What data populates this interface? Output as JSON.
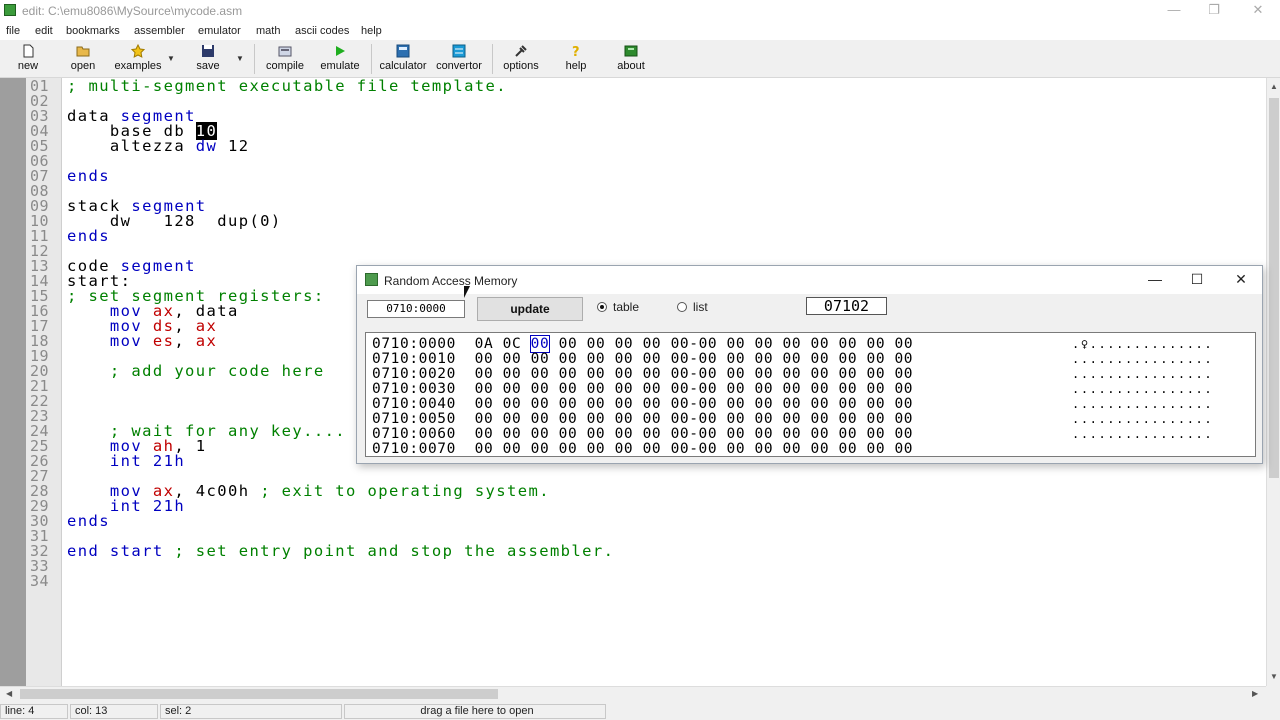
{
  "window": {
    "title": "edit: C:\\emu8086\\MySource\\mycode.asm",
    "min": "—",
    "max": "❐",
    "close": "✕"
  },
  "menu": [
    "file",
    "edit",
    "bookmarks",
    "assembler",
    "emulator",
    "math",
    "ascii codes",
    "help"
  ],
  "toolbar": {
    "new": "new",
    "open": "open",
    "examples": "examples",
    "save": "save",
    "compile": "compile",
    "emulate": "emulate",
    "calculator": "calculator",
    "convertor": "convertor",
    "options": "options",
    "help": "help",
    "about": "about"
  },
  "line_numbers": [
    "01",
    "02",
    "03",
    "04",
    "05",
    "06",
    "07",
    "08",
    "09",
    "10",
    "11",
    "12",
    "13",
    "14",
    "15",
    "16",
    "17",
    "18",
    "19",
    "20",
    "21",
    "22",
    "23",
    "24",
    "25",
    "26",
    "27",
    "28",
    "29",
    "30",
    "31",
    "32",
    "33",
    "34"
  ],
  "code": {
    "l01": "; multi-segment executable file template.",
    "l03a": "data ",
    "l03b": "segment",
    "l04a": "    base db ",
    "l04b": "10",
    "l05a": "    altezza ",
    "l05b": "dw",
    "l05c": " 12",
    "l07": "ends",
    "l09a": "stack ",
    "l09b": "segment",
    "l10": "    dw   128  dup(0)",
    "l11": "ends",
    "l13a": "code ",
    "l13b": "segment",
    "l14": "start:",
    "l15": "; set segment registers:",
    "l16a": "    mov ",
    "l16b": "ax",
    "l16c": ", data",
    "l17a": "    mov ",
    "l17b": "ds",
    "l17c": ", ",
    "l17d": "ax",
    "l18a": "    mov ",
    "l18b": "es",
    "l18c": ", ",
    "l18d": "ax",
    "l20": "    ; add your code here",
    "l24": "    ; wait for any key....",
    "l25a": "    mov ",
    "l25b": "ah",
    "l25c": ", 1",
    "l26": "    int 21h",
    "l28a": "    mov ",
    "l28b": "ax",
    "l28c": ", 4c00h ",
    "l28d": "; exit to operating system.",
    "l29": "    int 21h",
    "l30": "ends",
    "l32a": "end start ",
    "l32b": "; set entry point and stop the assembler."
  },
  "ram": {
    "title": "Random Access Memory",
    "address": "0710:0000",
    "update": "update",
    "table_label": "table",
    "list_label": "list",
    "selected_mode": "table",
    "value": "07102",
    "rows": [
      {
        "addr": "0710:0000",
        "b1": "0A 0C ",
        "b2": "00",
        "b3": " 00 00 00 00 00-00 00 00 00 00 00 00 00",
        "ascii": ".♀.............."
      },
      {
        "addr": "0710:0010",
        "b1": "00 00 00 00 00 00 00 00-00 00 00 00 00 00 00 00",
        "ascii": "................"
      },
      {
        "addr": "0710:0020",
        "b1": "00 00 00 00 00 00 00 00-00 00 00 00 00 00 00 00",
        "ascii": "................"
      },
      {
        "addr": "0710:0030",
        "b1": "00 00 00 00 00 00 00 00-00 00 00 00 00 00 00 00",
        "ascii": "................"
      },
      {
        "addr": "0710:0040",
        "b1": "00 00 00 00 00 00 00 00-00 00 00 00 00 00 00 00",
        "ascii": "................"
      },
      {
        "addr": "0710:0050",
        "b1": "00 00 00 00 00 00 00 00-00 00 00 00 00 00 00 00",
        "ascii": "................"
      },
      {
        "addr": "0710:0060",
        "b1": "00 00 00 00 00 00 00 00-00 00 00 00 00 00 00 00",
        "ascii": "................"
      },
      {
        "addr": "0710:0070",
        "b1": "00 00 00 00 00 00 00 00-00 00 00 00 00 00 00 00",
        "ascii": ""
      }
    ]
  },
  "status": {
    "line": "line: 4",
    "col": "col: 13",
    "sel": "sel: 2",
    "hint": "drag a file here to open"
  }
}
